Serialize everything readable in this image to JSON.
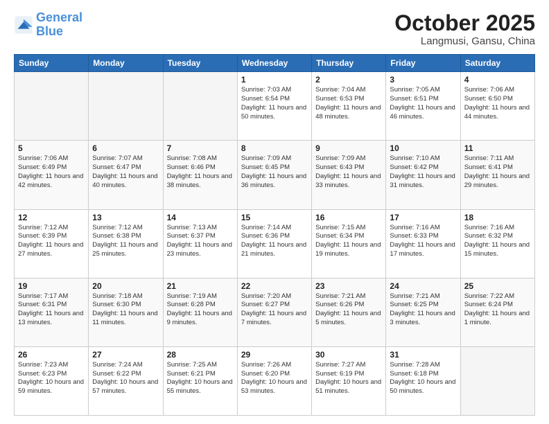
{
  "header": {
    "logo_general": "General",
    "logo_blue": "Blue",
    "month": "October 2025",
    "location": "Langmusi, Gansu, China"
  },
  "weekdays": [
    "Sunday",
    "Monday",
    "Tuesday",
    "Wednesday",
    "Thursday",
    "Friday",
    "Saturday"
  ],
  "weeks": [
    [
      {
        "day": "",
        "sunrise": "",
        "sunset": "",
        "daylight": "",
        "empty": true
      },
      {
        "day": "",
        "sunrise": "",
        "sunset": "",
        "daylight": "",
        "empty": true
      },
      {
        "day": "",
        "sunrise": "",
        "sunset": "",
        "daylight": "",
        "empty": true
      },
      {
        "day": "1",
        "sunrise": "Sunrise: 7:03 AM",
        "sunset": "Sunset: 6:54 PM",
        "daylight": "Daylight: 11 hours and 50 minutes.",
        "empty": false
      },
      {
        "day": "2",
        "sunrise": "Sunrise: 7:04 AM",
        "sunset": "Sunset: 6:53 PM",
        "daylight": "Daylight: 11 hours and 48 minutes.",
        "empty": false
      },
      {
        "day": "3",
        "sunrise": "Sunrise: 7:05 AM",
        "sunset": "Sunset: 6:51 PM",
        "daylight": "Daylight: 11 hours and 46 minutes.",
        "empty": false
      },
      {
        "day": "4",
        "sunrise": "Sunrise: 7:06 AM",
        "sunset": "Sunset: 6:50 PM",
        "daylight": "Daylight: 11 hours and 44 minutes.",
        "empty": false
      }
    ],
    [
      {
        "day": "5",
        "sunrise": "Sunrise: 7:06 AM",
        "sunset": "Sunset: 6:49 PM",
        "daylight": "Daylight: 11 hours and 42 minutes.",
        "empty": false
      },
      {
        "day": "6",
        "sunrise": "Sunrise: 7:07 AM",
        "sunset": "Sunset: 6:47 PM",
        "daylight": "Daylight: 11 hours and 40 minutes.",
        "empty": false
      },
      {
        "day": "7",
        "sunrise": "Sunrise: 7:08 AM",
        "sunset": "Sunset: 6:46 PM",
        "daylight": "Daylight: 11 hours and 38 minutes.",
        "empty": false
      },
      {
        "day": "8",
        "sunrise": "Sunrise: 7:09 AM",
        "sunset": "Sunset: 6:45 PM",
        "daylight": "Daylight: 11 hours and 36 minutes.",
        "empty": false
      },
      {
        "day": "9",
        "sunrise": "Sunrise: 7:09 AM",
        "sunset": "Sunset: 6:43 PM",
        "daylight": "Daylight: 11 hours and 33 minutes.",
        "empty": false
      },
      {
        "day": "10",
        "sunrise": "Sunrise: 7:10 AM",
        "sunset": "Sunset: 6:42 PM",
        "daylight": "Daylight: 11 hours and 31 minutes.",
        "empty": false
      },
      {
        "day": "11",
        "sunrise": "Sunrise: 7:11 AM",
        "sunset": "Sunset: 6:41 PM",
        "daylight": "Daylight: 11 hours and 29 minutes.",
        "empty": false
      }
    ],
    [
      {
        "day": "12",
        "sunrise": "Sunrise: 7:12 AM",
        "sunset": "Sunset: 6:39 PM",
        "daylight": "Daylight: 11 hours and 27 minutes.",
        "empty": false
      },
      {
        "day": "13",
        "sunrise": "Sunrise: 7:12 AM",
        "sunset": "Sunset: 6:38 PM",
        "daylight": "Daylight: 11 hours and 25 minutes.",
        "empty": false
      },
      {
        "day": "14",
        "sunrise": "Sunrise: 7:13 AM",
        "sunset": "Sunset: 6:37 PM",
        "daylight": "Daylight: 11 hours and 23 minutes.",
        "empty": false
      },
      {
        "day": "15",
        "sunrise": "Sunrise: 7:14 AM",
        "sunset": "Sunset: 6:36 PM",
        "daylight": "Daylight: 11 hours and 21 minutes.",
        "empty": false
      },
      {
        "day": "16",
        "sunrise": "Sunrise: 7:15 AM",
        "sunset": "Sunset: 6:34 PM",
        "daylight": "Daylight: 11 hours and 19 minutes.",
        "empty": false
      },
      {
        "day": "17",
        "sunrise": "Sunrise: 7:16 AM",
        "sunset": "Sunset: 6:33 PM",
        "daylight": "Daylight: 11 hours and 17 minutes.",
        "empty": false
      },
      {
        "day": "18",
        "sunrise": "Sunrise: 7:16 AM",
        "sunset": "Sunset: 6:32 PM",
        "daylight": "Daylight: 11 hours and 15 minutes.",
        "empty": false
      }
    ],
    [
      {
        "day": "19",
        "sunrise": "Sunrise: 7:17 AM",
        "sunset": "Sunset: 6:31 PM",
        "daylight": "Daylight: 11 hours and 13 minutes.",
        "empty": false
      },
      {
        "day": "20",
        "sunrise": "Sunrise: 7:18 AM",
        "sunset": "Sunset: 6:30 PM",
        "daylight": "Daylight: 11 hours and 11 minutes.",
        "empty": false
      },
      {
        "day": "21",
        "sunrise": "Sunrise: 7:19 AM",
        "sunset": "Sunset: 6:28 PM",
        "daylight": "Daylight: 11 hours and 9 minutes.",
        "empty": false
      },
      {
        "day": "22",
        "sunrise": "Sunrise: 7:20 AM",
        "sunset": "Sunset: 6:27 PM",
        "daylight": "Daylight: 11 hours and 7 minutes.",
        "empty": false
      },
      {
        "day": "23",
        "sunrise": "Sunrise: 7:21 AM",
        "sunset": "Sunset: 6:26 PM",
        "daylight": "Daylight: 11 hours and 5 minutes.",
        "empty": false
      },
      {
        "day": "24",
        "sunrise": "Sunrise: 7:21 AM",
        "sunset": "Sunset: 6:25 PM",
        "daylight": "Daylight: 11 hours and 3 minutes.",
        "empty": false
      },
      {
        "day": "25",
        "sunrise": "Sunrise: 7:22 AM",
        "sunset": "Sunset: 6:24 PM",
        "daylight": "Daylight: 11 hours and 1 minute.",
        "empty": false
      }
    ],
    [
      {
        "day": "26",
        "sunrise": "Sunrise: 7:23 AM",
        "sunset": "Sunset: 6:23 PM",
        "daylight": "Daylight: 10 hours and 59 minutes.",
        "empty": false
      },
      {
        "day": "27",
        "sunrise": "Sunrise: 7:24 AM",
        "sunset": "Sunset: 6:22 PM",
        "daylight": "Daylight: 10 hours and 57 minutes.",
        "empty": false
      },
      {
        "day": "28",
        "sunrise": "Sunrise: 7:25 AM",
        "sunset": "Sunset: 6:21 PM",
        "daylight": "Daylight: 10 hours and 55 minutes.",
        "empty": false
      },
      {
        "day": "29",
        "sunrise": "Sunrise: 7:26 AM",
        "sunset": "Sunset: 6:20 PM",
        "daylight": "Daylight: 10 hours and 53 minutes.",
        "empty": false
      },
      {
        "day": "30",
        "sunrise": "Sunrise: 7:27 AM",
        "sunset": "Sunset: 6:19 PM",
        "daylight": "Daylight: 10 hours and 51 minutes.",
        "empty": false
      },
      {
        "day": "31",
        "sunrise": "Sunrise: 7:28 AM",
        "sunset": "Sunset: 6:18 PM",
        "daylight": "Daylight: 10 hours and 50 minutes.",
        "empty": false
      },
      {
        "day": "",
        "sunrise": "",
        "sunset": "",
        "daylight": "",
        "empty": true
      }
    ]
  ]
}
